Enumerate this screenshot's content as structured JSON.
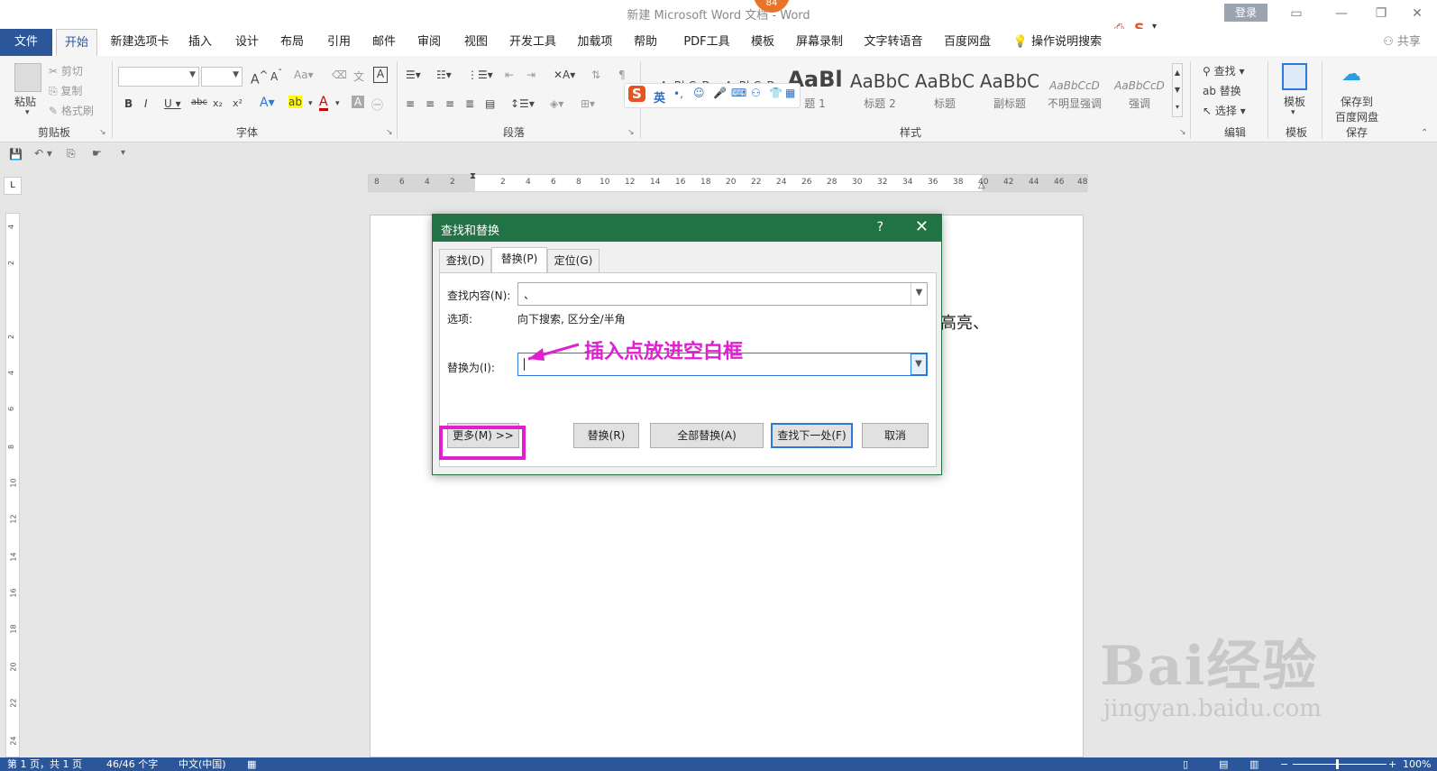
{
  "window": {
    "title": "新建 Microsoft Word 文档 - Word",
    "badge": "84",
    "login": "登录",
    "share": "共享"
  },
  "ribbon_tabs": [
    "文件",
    "开始",
    "新建选项卡",
    "插入",
    "设计",
    "布局",
    "引用",
    "邮件",
    "审阅",
    "视图",
    "开发工具",
    "加载项",
    "帮助",
    "PDF工具",
    "模板",
    "屏幕录制",
    "文字转语音",
    "百度网盘"
  ],
  "tell_me": "操作说明搜索",
  "clipboard": {
    "paste": "粘贴",
    "cut": "剪切",
    "copy": "复制",
    "format_painter": "格式刷",
    "label": "剪贴板"
  },
  "font_group": {
    "label": "字体"
  },
  "paragraph_group": {
    "label": "段落"
  },
  "styles": {
    "label": "样式",
    "items": [
      {
        "sample": "AaBbCcD",
        "name": ""
      },
      {
        "sample": "AaBbCcD",
        "name": ""
      },
      {
        "sample": "AaBl",
        "name": "题 1"
      },
      {
        "sample": "AaBbC",
        "name": "标题 2"
      },
      {
        "sample": "AaBbC",
        "name": "标题"
      },
      {
        "sample": "AaBbC",
        "name": "副标题"
      },
      {
        "sample": "AaBbCcD",
        "name": "不明显强调"
      },
      {
        "sample": "AaBbCcD",
        "name": "强调"
      }
    ]
  },
  "editing": {
    "find": "查找",
    "replace": "替换",
    "select": "选择",
    "label": "编辑"
  },
  "template": {
    "button": "模板",
    "label": "模板"
  },
  "save_group": {
    "button_line1": "保存到",
    "button_line2": "百度网盘",
    "label": "保存"
  },
  "ime": {
    "mode": "英"
  },
  "ruler": {
    "ticks": [
      "8",
      "6",
      "4",
      "2",
      "",
      "2",
      "4",
      "6",
      "8",
      "10",
      "12",
      "14",
      "16",
      "18",
      "20",
      "22",
      "24",
      "26",
      "28",
      "30",
      "32",
      "34",
      "36",
      "38",
      "40",
      "42",
      "44",
      "46",
      "48"
    ]
  },
  "vruler": {
    "ticks": [
      "4",
      "2",
      "",
      "2",
      "4",
      "6",
      "8",
      "10",
      "12",
      "14",
      "16",
      "18",
      "20",
      "22",
      "24"
    ]
  },
  "document": {
    "visible_text": "高亮、"
  },
  "dialog": {
    "title": "查找和替换",
    "help": "?",
    "close": "✕",
    "tabs": [
      "查找(D)",
      "替换(P)",
      "定位(G)"
    ],
    "find_label": "查找内容(N):",
    "find_value": "、",
    "options_label": "选项:",
    "options_value": "向下搜索, 区分全/半角",
    "replace_label": "替换为(I):",
    "replace_value": "",
    "buttons": {
      "more": "更多(M) >>",
      "replace": "替换(R)",
      "replace_all": "全部替换(A)",
      "find_next": "查找下一处(F)",
      "cancel": "取消"
    }
  },
  "annotation": {
    "text": "插入点放进空白框"
  },
  "status_bar": {
    "page": "第 1 页，共 1 页",
    "words": "46/46 个字",
    "language": "中文(中国)",
    "zoom": "100%"
  },
  "watermark": {
    "logo": "Bai经验",
    "url": "jingyan.baidu.com"
  },
  "colors": {
    "word_blue": "#2b579a",
    "dialog_green": "#217346",
    "highlight_magenta": "#e020d0"
  }
}
